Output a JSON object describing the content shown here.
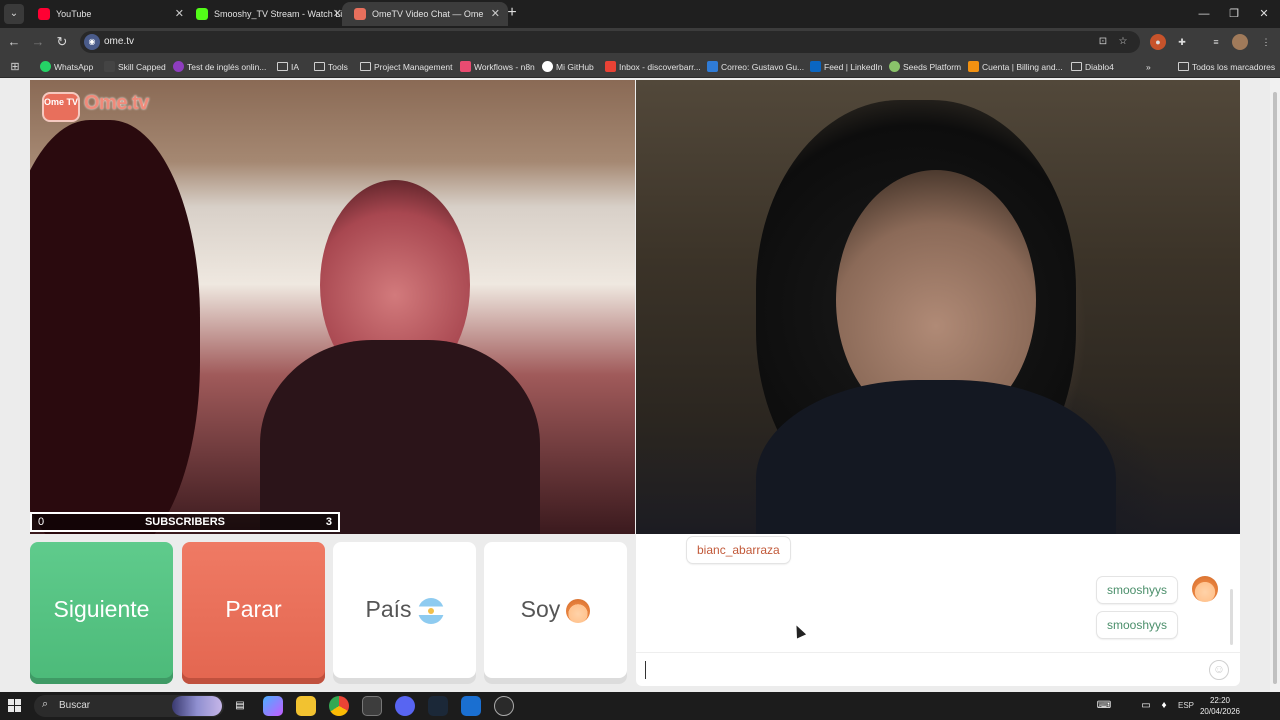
{
  "browser": {
    "tabs": [
      {
        "title": "YouTube",
        "favicon_color": "#ff0033",
        "active": false
      },
      {
        "title": "Smooshy_TV Stream - Watch Li",
        "favicon_color": "#53fc18",
        "active": false
      },
      {
        "title": "OmeTV Video Chat — Ome",
        "favicon_color": "#e86f5c",
        "active": true
      }
    ],
    "new_tab_label": "+",
    "url": "ome.tv",
    "bookmarks": [
      {
        "label": "WhatsApp",
        "icon": "whatsapp-icon",
        "color": "#25d366"
      },
      {
        "label": "Skill Capped",
        "icon": "skillcapped-icon",
        "color": "#444444"
      },
      {
        "label": "Test de inglés onlin...",
        "icon": "test-icon",
        "color": "#8e3dbf"
      },
      {
        "label": "IA",
        "icon": "folder-icon"
      },
      {
        "label": "Tools",
        "icon": "folder-icon"
      },
      {
        "label": "Project Management",
        "icon": "folder-icon"
      },
      {
        "label": "Workflows - n8n",
        "icon": "n8n-icon",
        "color": "#ea4b71"
      },
      {
        "label": "Mi GitHub",
        "icon": "github-icon",
        "color": "#ffffff"
      },
      {
        "label": "Inbox - discoverbarr...",
        "icon": "mail-icon",
        "color": "#e94235"
      },
      {
        "label": "Correo: Gustavo Gu...",
        "icon": "outlook-icon",
        "color": "#2f7bd6"
      },
      {
        "label": "Feed | LinkedIn",
        "icon": "linkedin-icon",
        "color": "#0a66c2"
      },
      {
        "label": "Seeds Platform",
        "icon": "seeds-icon",
        "color": "#8ac26a"
      },
      {
        "label": "Cuenta | Billing and...",
        "icon": "aws-icon",
        "color": "#f29111"
      },
      {
        "label": "Diablo4",
        "icon": "folder-icon"
      }
    ],
    "bookmarks_more": "»",
    "all_bookmarks": "Todos los marcadores"
  },
  "ometv": {
    "logo_box_text": "Ome TV",
    "logo_text": "Ome.tv",
    "subscribers": {
      "left_count": "0",
      "label": "SUBSCRIBERS",
      "right_count": "3"
    },
    "buttons": {
      "next": "Siguiente",
      "stop": "Parar",
      "country": "País",
      "me": "Soy"
    },
    "chat": {
      "messages": [
        {
          "from": "them",
          "text": "bianc_abarraza"
        },
        {
          "from": "me",
          "text": "smooshyys"
        },
        {
          "from": "me",
          "text": "smooshyys"
        }
      ],
      "input_value": ""
    },
    "colors": {
      "next": "#5fcb8c",
      "stop": "#ef7a64",
      "them_text": "#c25a3a",
      "me_text": "#4b8f6b"
    }
  },
  "taskbar": {
    "search_placeholder": "Buscar",
    "language": "ESP",
    "time": "22:20",
    "date": "20/04/2026"
  }
}
